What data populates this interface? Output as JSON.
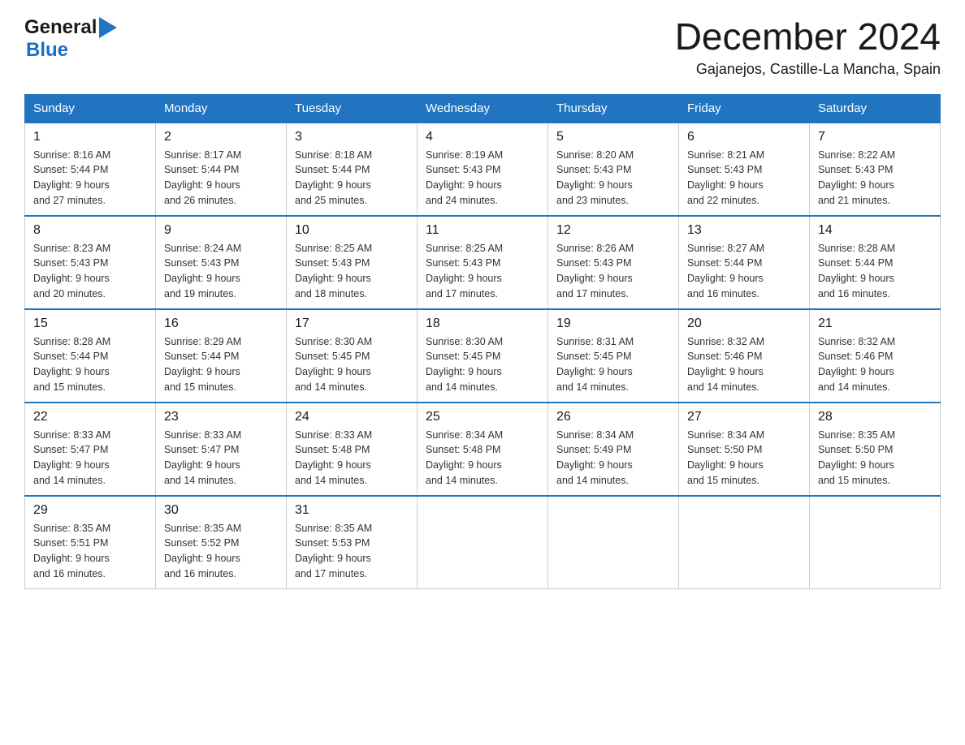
{
  "logo": {
    "general": "General",
    "blue": "Blue"
  },
  "title": "December 2024",
  "subtitle": "Gajanejos, Castille-La Mancha, Spain",
  "days_of_week": [
    "Sunday",
    "Monday",
    "Tuesday",
    "Wednesday",
    "Thursday",
    "Friday",
    "Saturday"
  ],
  "weeks": [
    [
      {
        "day": "1",
        "sunrise": "8:16 AM",
        "sunset": "5:44 PM",
        "daylight": "9 hours and 27 minutes."
      },
      {
        "day": "2",
        "sunrise": "8:17 AM",
        "sunset": "5:44 PM",
        "daylight": "9 hours and 26 minutes."
      },
      {
        "day": "3",
        "sunrise": "8:18 AM",
        "sunset": "5:44 PM",
        "daylight": "9 hours and 25 minutes."
      },
      {
        "day": "4",
        "sunrise": "8:19 AM",
        "sunset": "5:43 PM",
        "daylight": "9 hours and 24 minutes."
      },
      {
        "day": "5",
        "sunrise": "8:20 AM",
        "sunset": "5:43 PM",
        "daylight": "9 hours and 23 minutes."
      },
      {
        "day": "6",
        "sunrise": "8:21 AM",
        "sunset": "5:43 PM",
        "daylight": "9 hours and 22 minutes."
      },
      {
        "day": "7",
        "sunrise": "8:22 AM",
        "sunset": "5:43 PM",
        "daylight": "9 hours and 21 minutes."
      }
    ],
    [
      {
        "day": "8",
        "sunrise": "8:23 AM",
        "sunset": "5:43 PM",
        "daylight": "9 hours and 20 minutes."
      },
      {
        "day": "9",
        "sunrise": "8:24 AM",
        "sunset": "5:43 PM",
        "daylight": "9 hours and 19 minutes."
      },
      {
        "day": "10",
        "sunrise": "8:25 AM",
        "sunset": "5:43 PM",
        "daylight": "9 hours and 18 minutes."
      },
      {
        "day": "11",
        "sunrise": "8:25 AM",
        "sunset": "5:43 PM",
        "daylight": "9 hours and 17 minutes."
      },
      {
        "day": "12",
        "sunrise": "8:26 AM",
        "sunset": "5:43 PM",
        "daylight": "9 hours and 17 minutes."
      },
      {
        "day": "13",
        "sunrise": "8:27 AM",
        "sunset": "5:44 PM",
        "daylight": "9 hours and 16 minutes."
      },
      {
        "day": "14",
        "sunrise": "8:28 AM",
        "sunset": "5:44 PM",
        "daylight": "9 hours and 16 minutes."
      }
    ],
    [
      {
        "day": "15",
        "sunrise": "8:28 AM",
        "sunset": "5:44 PM",
        "daylight": "9 hours and 15 minutes."
      },
      {
        "day": "16",
        "sunrise": "8:29 AM",
        "sunset": "5:44 PM",
        "daylight": "9 hours and 15 minutes."
      },
      {
        "day": "17",
        "sunrise": "8:30 AM",
        "sunset": "5:45 PM",
        "daylight": "9 hours and 14 minutes."
      },
      {
        "day": "18",
        "sunrise": "8:30 AM",
        "sunset": "5:45 PM",
        "daylight": "9 hours and 14 minutes."
      },
      {
        "day": "19",
        "sunrise": "8:31 AM",
        "sunset": "5:45 PM",
        "daylight": "9 hours and 14 minutes."
      },
      {
        "day": "20",
        "sunrise": "8:32 AM",
        "sunset": "5:46 PM",
        "daylight": "9 hours and 14 minutes."
      },
      {
        "day": "21",
        "sunrise": "8:32 AM",
        "sunset": "5:46 PM",
        "daylight": "9 hours and 14 minutes."
      }
    ],
    [
      {
        "day": "22",
        "sunrise": "8:33 AM",
        "sunset": "5:47 PM",
        "daylight": "9 hours and 14 minutes."
      },
      {
        "day": "23",
        "sunrise": "8:33 AM",
        "sunset": "5:47 PM",
        "daylight": "9 hours and 14 minutes."
      },
      {
        "day": "24",
        "sunrise": "8:33 AM",
        "sunset": "5:48 PM",
        "daylight": "9 hours and 14 minutes."
      },
      {
        "day": "25",
        "sunrise": "8:34 AM",
        "sunset": "5:48 PM",
        "daylight": "9 hours and 14 minutes."
      },
      {
        "day": "26",
        "sunrise": "8:34 AM",
        "sunset": "5:49 PM",
        "daylight": "9 hours and 14 minutes."
      },
      {
        "day": "27",
        "sunrise": "8:34 AM",
        "sunset": "5:50 PM",
        "daylight": "9 hours and 15 minutes."
      },
      {
        "day": "28",
        "sunrise": "8:35 AM",
        "sunset": "5:50 PM",
        "daylight": "9 hours and 15 minutes."
      }
    ],
    [
      {
        "day": "29",
        "sunrise": "8:35 AM",
        "sunset": "5:51 PM",
        "daylight": "9 hours and 16 minutes."
      },
      {
        "day": "30",
        "sunrise": "8:35 AM",
        "sunset": "5:52 PM",
        "daylight": "9 hours and 16 minutes."
      },
      {
        "day": "31",
        "sunrise": "8:35 AM",
        "sunset": "5:53 PM",
        "daylight": "9 hours and 17 minutes."
      },
      null,
      null,
      null,
      null
    ]
  ],
  "labels": {
    "sunrise": "Sunrise:",
    "sunset": "Sunset:",
    "daylight": "Daylight:"
  }
}
